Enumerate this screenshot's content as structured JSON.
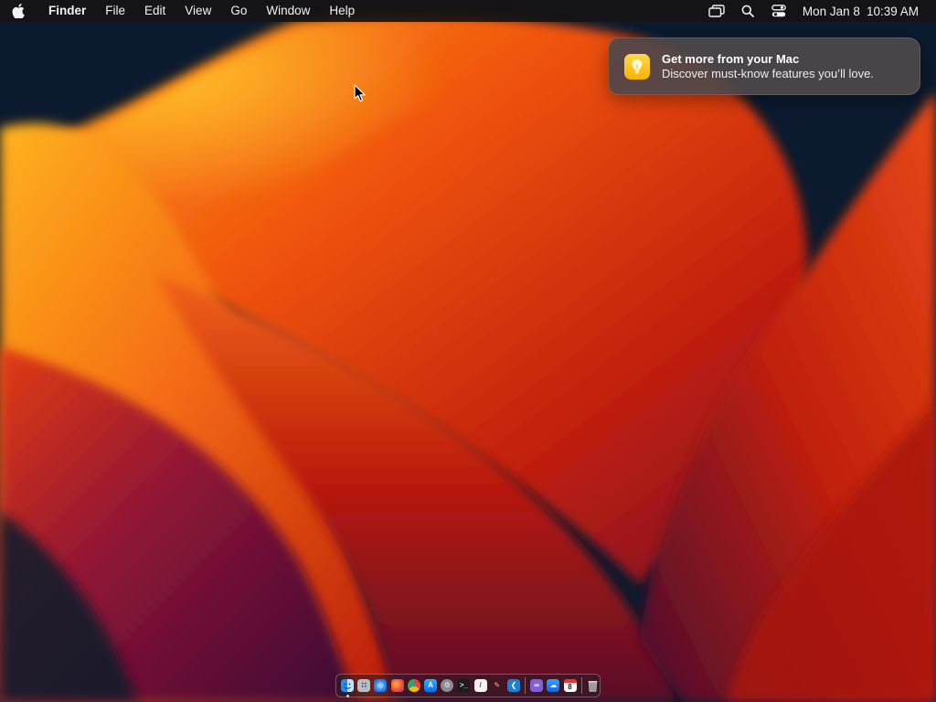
{
  "menubar": {
    "apple_icon": "apple-logo-icon",
    "app_name": "Finder",
    "menus": [
      "File",
      "Edit",
      "View",
      "Go",
      "Window",
      "Help"
    ],
    "status_icons": [
      "screen-mirroring-icon",
      "spotlight-search-icon",
      "control-center-icon"
    ],
    "clock": {
      "date": "Mon Jan 8",
      "time": "10:39 AM"
    }
  },
  "notification": {
    "app_icon": "tips-lightbulb-icon",
    "title": "Get more from your Mac",
    "body": "Discover must-know features you’ll love."
  },
  "dock": {
    "apps": [
      {
        "name": "finder-icon",
        "running": true
      },
      {
        "name": "launchpad-icon",
        "running": false
      },
      {
        "name": "safari-icon",
        "running": false
      },
      {
        "name": "firefox-icon",
        "running": false
      },
      {
        "name": "chrome-icon",
        "running": false
      },
      {
        "name": "app-store-icon",
        "running": false
      },
      {
        "name": "system-settings-icon",
        "running": false
      },
      {
        "name": "terminal-icon",
        "running": false
      },
      {
        "name": "textedit-icon",
        "running": false
      },
      {
        "name": "paintbrush-icon",
        "running": false
      },
      {
        "name": "vscode-icon",
        "running": false
      }
    ],
    "recents": [
      {
        "name": "visual-studio-icon",
        "running": false
      },
      {
        "name": "cloud-drive-icon",
        "running": false
      },
      {
        "name": "calendar-icon",
        "running": false,
        "day": "8"
      }
    ],
    "trash": {
      "name": "trash-icon"
    }
  },
  "colors": {
    "menubar_bg": "#161214",
    "notification_bg": "#4e484a",
    "tips_yellow": "#f5b400",
    "wallpaper_orange": "#f07a10",
    "wallpaper_red": "#c8200c",
    "wallpaper_purple": "#5c1044",
    "wallpaper_navy": "#0b1a2e"
  }
}
